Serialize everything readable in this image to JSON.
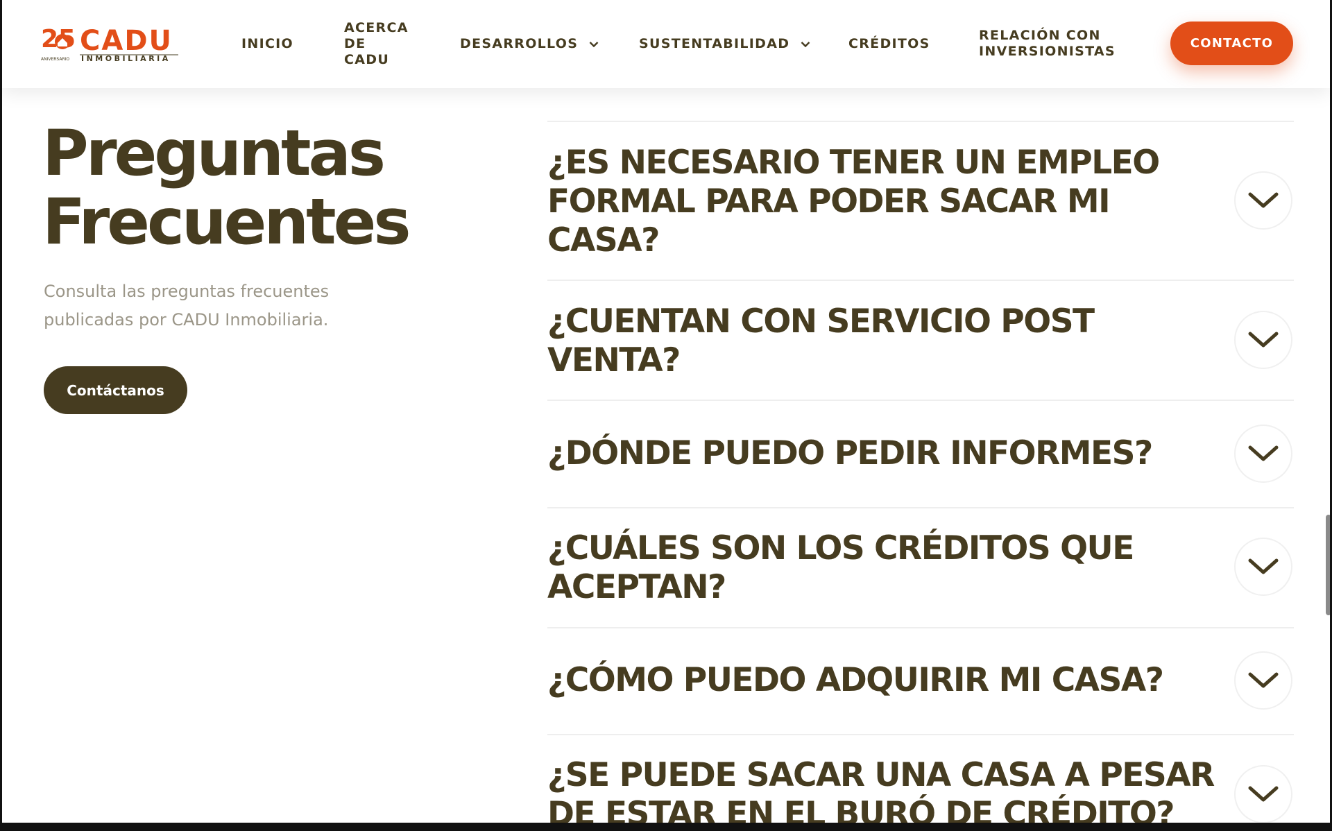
{
  "header": {
    "logo": {
      "anniversary_number": "25",
      "anniversary_label": "ANIVERSARIO",
      "brand": "CADU",
      "brand_sub": "INMOBILIARIA"
    },
    "nav": [
      {
        "label": "INICIO",
        "has_dropdown": false
      },
      {
        "label": "ACERCA DE CADU",
        "has_dropdown": false
      },
      {
        "label": "DESARROLLOS",
        "has_dropdown": true
      },
      {
        "label": "SUSTENTABILIDAD",
        "has_dropdown": true
      },
      {
        "label": "CRÉDITOS",
        "has_dropdown": false
      },
      {
        "label": "RELACIÓN CON INVERSIONISTAS",
        "has_dropdown": false
      }
    ],
    "acerca_lines": [
      "ACERCA",
      "DE",
      "CADU"
    ],
    "relacion_lines": [
      "RELACIÓN CON",
      "INVERSIONISTAS"
    ],
    "contact_label": "CONTACTO"
  },
  "hero": {
    "title_line1": "Preguntas",
    "title_line2": "Frecuentes",
    "subtitle_line1": "Consulta las preguntas frecuentes",
    "subtitle_line2": "publicadas por CADU Inmobiliaria.",
    "cta_label": "Contáctanos"
  },
  "faq": [
    {
      "question": "¿ES NECESARIO TENER UN EMPLEO FORMAL PARA PODER SACAR MI CASA?",
      "lines": [
        "¿ES NECESARIO TENER UN EMPLEO",
        "FORMAL PARA PODER SACAR MI",
        "CASA?"
      ],
      "expanded": false
    },
    {
      "question": "¿CUENTAN CON SERVICIO POST VENTA?",
      "lines": [
        "¿CUENTAN CON SERVICIO POST",
        "VENTA?"
      ],
      "expanded": false
    },
    {
      "question": "¿DÓNDE PUEDO PEDIR INFORMES?",
      "lines": [
        "¿DÓNDE PUEDO PEDIR INFORMES?"
      ],
      "expanded": false
    },
    {
      "question": "¿CUÁLES SON LOS CRÉDITOS QUE ACEPTAN?",
      "lines": [
        "¿CUÁLES SON LOS CRÉDITOS QUE",
        "ACEPTAN?"
      ],
      "expanded": false
    },
    {
      "question": "¿CÓMO PUEDO ADQUIRIR MI CASA?",
      "lines": [
        "¿CÓMO PUEDO ADQUIRIR MI CASA?"
      ],
      "expanded": false
    },
    {
      "question": "¿SE PUEDE SACAR UNA CASA A PESAR DE ESTAR EN EL BURÓ DE CRÉDITO?",
      "lines": [
        "¿SE PUEDE SACAR UNA CASA A PESAR",
        "DE ESTAR EN EL BURÓ DE CRÉDITO?"
      ],
      "expanded": false
    }
  ],
  "colors": {
    "brand_orange": "#e24e18",
    "brand_brown": "#463c20",
    "subtitle_gray": "#9b9688"
  },
  "icons": {
    "dropdown": "chevron-down-icon",
    "faq_toggle": "chevron-down-icon",
    "logo_house": "house-icon"
  }
}
